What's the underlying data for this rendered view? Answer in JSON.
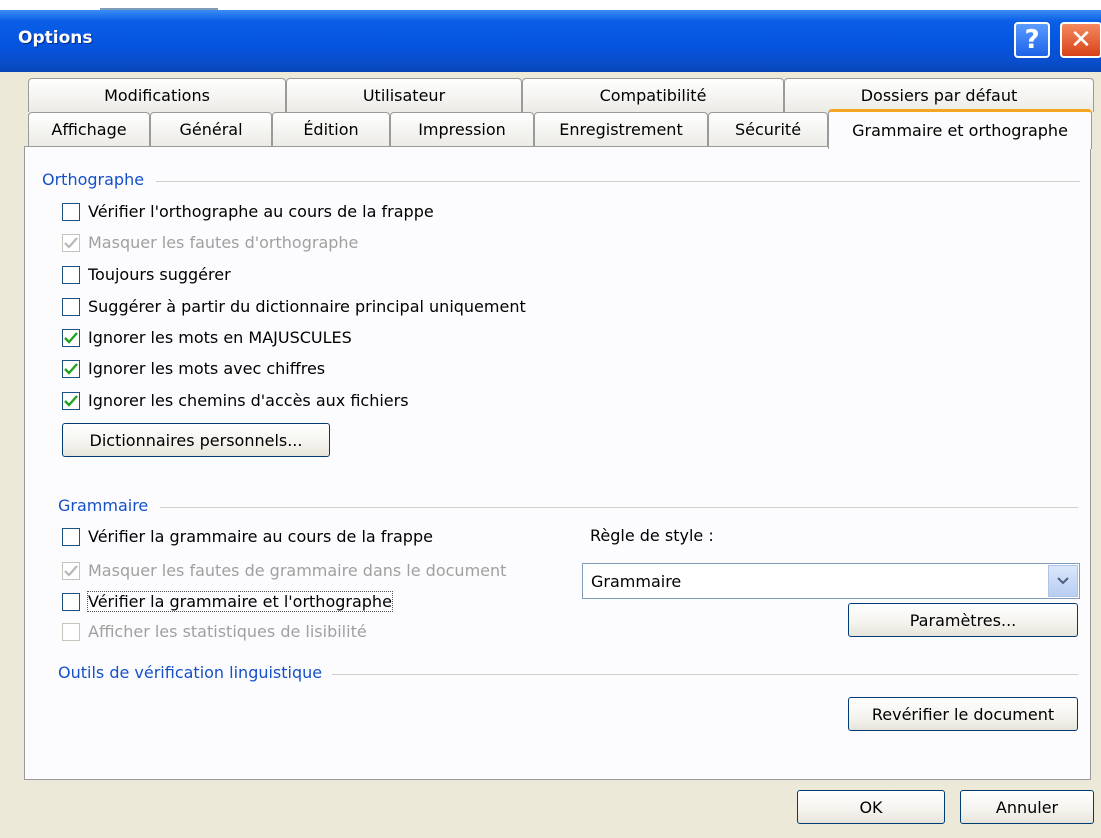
{
  "window": {
    "title": "Options",
    "help_glyph": "?",
    "close_glyph": "✕"
  },
  "tabs": {
    "row1": [
      "Modifications",
      "Utilisateur",
      "Compatibilité",
      "Dossiers par défaut"
    ],
    "row2": [
      "Affichage",
      "Général",
      "Édition",
      "Impression",
      "Enregistrement",
      "Sécurité",
      "Grammaire et orthographe"
    ],
    "active": "Grammaire et orthographe"
  },
  "spelling": {
    "section_title": "Orthographe",
    "options": [
      {
        "label": "Vérifier l'orthographe au cours de la frappe",
        "checked": false,
        "disabled": false
      },
      {
        "label": "Masquer les fautes d'orthographe",
        "checked": true,
        "disabled": true
      },
      {
        "label": "Toujours suggérer",
        "checked": false,
        "disabled": false
      },
      {
        "label": "Suggérer à partir du dictionnaire principal uniquement",
        "checked": false,
        "disabled": false
      },
      {
        "label": "Ignorer les mots en MAJUSCULES",
        "checked": true,
        "disabled": false
      },
      {
        "label": "Ignorer les mots avec chiffres",
        "checked": true,
        "disabled": false
      },
      {
        "label": "Ignorer les chemins d'accès aux fichiers",
        "checked": true,
        "disabled": false
      }
    ],
    "dictionaries_button": "Dictionnaires personnels..."
  },
  "grammar": {
    "section_title": "Grammaire",
    "options": [
      {
        "label": "Vérifier la grammaire au cours de la frappe",
        "checked": false,
        "disabled": false
      },
      {
        "label": "Masquer les fautes de grammaire dans le document",
        "checked": true,
        "disabled": true
      },
      {
        "label": "Vérifier la grammaire et l'orthographe",
        "checked": false,
        "disabled": false
      },
      {
        "label": "Afficher les statistiques de lisibilité",
        "checked": false,
        "disabled": true
      }
    ],
    "style_rule_label": "Règle de style :",
    "style_rule_value": "Grammaire",
    "settings_button": "Paramètres..."
  },
  "proofing": {
    "section_title": "Outils de vérification linguistique",
    "recheck_button": "Revérifier le document"
  },
  "footer": {
    "ok": "OK",
    "cancel": "Annuler"
  },
  "colors": {
    "titlebar": "#0554e0",
    "section_text": "#1550c8",
    "active_tab_accent": "#f4a622",
    "check_green": "#21a121",
    "check_disabled": "#b8b8b8"
  }
}
